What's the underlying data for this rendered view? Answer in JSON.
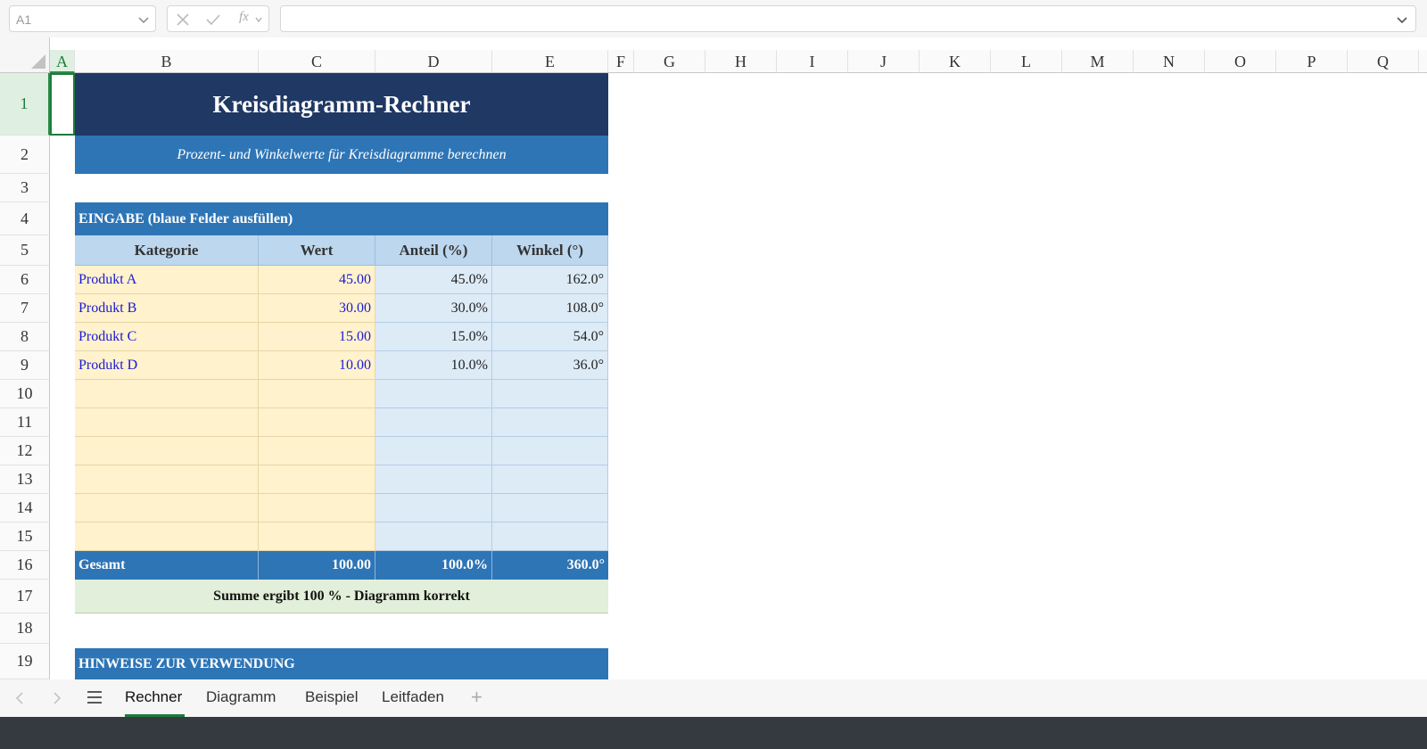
{
  "formula_bar": {
    "name_box": "A1",
    "fx_label": "fx",
    "formula": ""
  },
  "columns": [
    "A",
    "B",
    "C",
    "D",
    "E",
    "F",
    "G",
    "H",
    "I",
    "J",
    "K",
    "L",
    "M",
    "N",
    "O",
    "P",
    "Q"
  ],
  "rows": [
    "1",
    "2",
    "3",
    "4",
    "5",
    "6",
    "7",
    "8",
    "9",
    "10",
    "11",
    "12",
    "13",
    "14",
    "15",
    "16",
    "17",
    "18",
    "19"
  ],
  "sheet": {
    "title": "Kreisdiagramm-Rechner",
    "subtitle": "Prozent- und Winkelwerte für Kreisdiagramme berechnen",
    "input_header": "EINGABE (blaue Felder ausfüllen)",
    "table_headers": [
      "Kategorie",
      "Wert",
      "Anteil (%)",
      "Winkel (°)"
    ],
    "data_rows": [
      {
        "kategorie": "Produkt A",
        "wert": "45.00",
        "anteil": "45.0%",
        "winkel": "162.0°"
      },
      {
        "kategorie": "Produkt B",
        "wert": "30.00",
        "anteil": "30.0%",
        "winkel": "108.0°"
      },
      {
        "kategorie": "Produkt C",
        "wert": "15.00",
        "anteil": "15.0%",
        "winkel": "54.0°"
      },
      {
        "kategorie": "Produkt D",
        "wert": "10.00",
        "anteil": "10.0%",
        "winkel": "36.0°"
      }
    ],
    "total": {
      "label": "Gesamt",
      "wert": "100.00",
      "anteil": "100.0%",
      "winkel": "360.0°"
    },
    "status": "Summe ergibt 100 % - Diagramm korrekt",
    "hints_header": "HINWEISE ZUR VERWENDUNG"
  },
  "sheet_tabs": [
    "Rechner",
    "Diagramm",
    "Beispiel",
    "Leitfaden"
  ],
  "active_tab": "Rechner",
  "colors": {
    "title_bg": "#1f3864",
    "header_blue": "#2e75b6",
    "table_header": "#bdd7ee",
    "input_fill": "#fff2cc",
    "output_fill": "#ddebf7",
    "status_fill": "#e2efda",
    "selection": "#1e7b3c"
  }
}
